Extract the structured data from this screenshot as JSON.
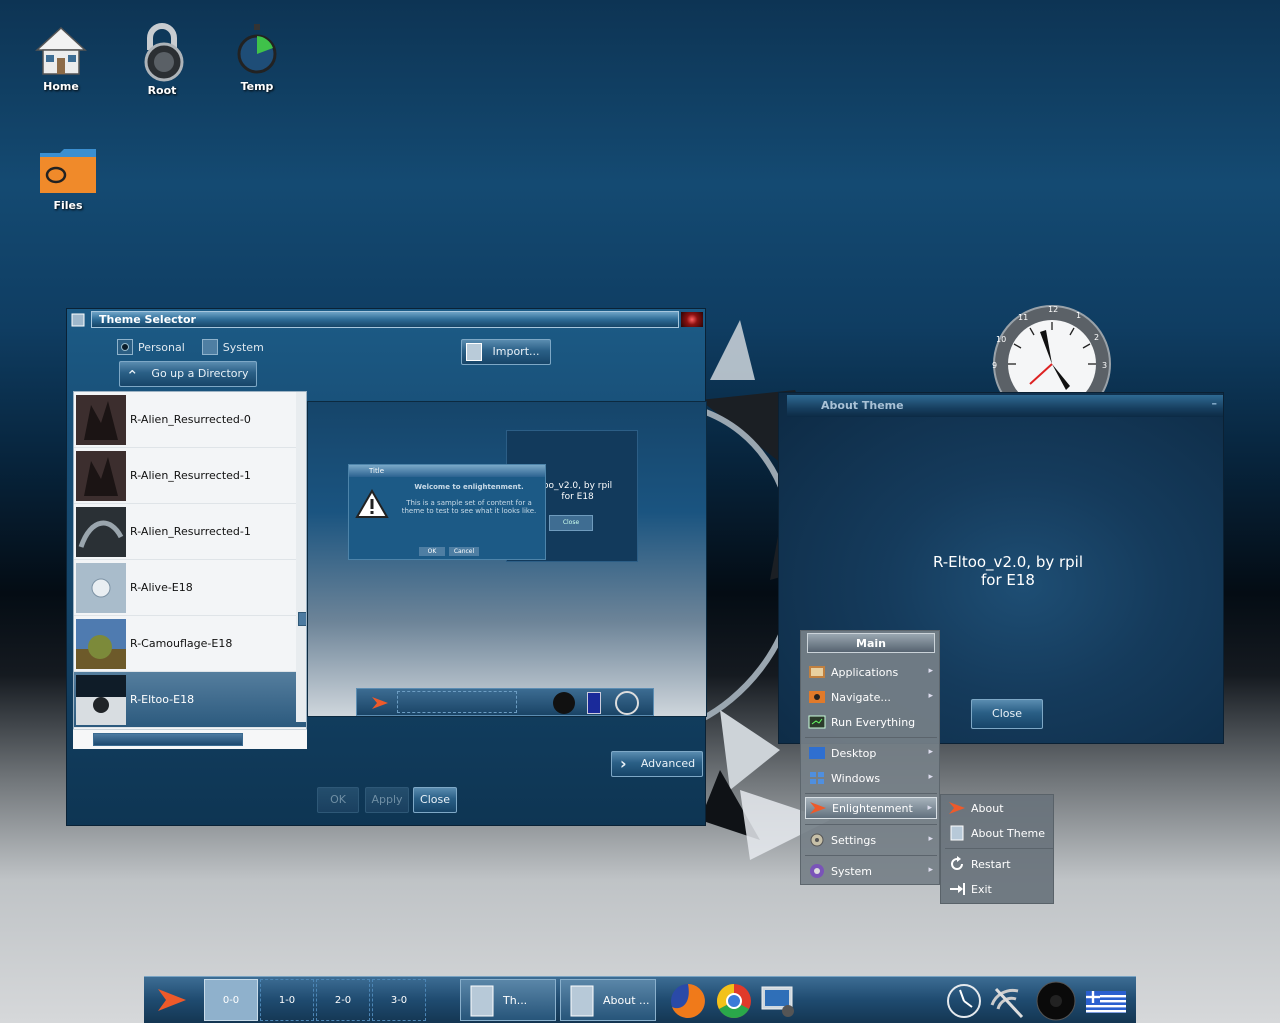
{
  "desktop": {
    "icons": [
      {
        "label": "Home"
      },
      {
        "label": "Root"
      },
      {
        "label": "Temp"
      },
      {
        "label": "Files"
      }
    ]
  },
  "clock": {
    "numbers": [
      "12",
      "1",
      "2",
      "3",
      "9",
      "10",
      "11"
    ]
  },
  "theme_selector": {
    "title": "Theme Selector",
    "radio_personal": "Personal",
    "radio_system": "System",
    "selected_source": "Personal",
    "import_button": "Import...",
    "go_up_button": "Go up a Directory",
    "themes": [
      {
        "name": "R-Alien_Resurrected-0"
      },
      {
        "name": "R-Alien_Resurrected-1"
      },
      {
        "name": "R-Alien_Resurrected-1"
      },
      {
        "name": "R-Alive-E18"
      },
      {
        "name": "R-Camouflage-E18"
      },
      {
        "name": "R-Eltoo-E18"
      }
    ],
    "selected_theme": "R-Eltoo-E18",
    "preview": {
      "dialog_title": "Title",
      "dialog_heading": "Welcome to enlightenment.",
      "dialog_body": "This is a sample set of content for a theme to test to see what it looks like.",
      "dialog_ok": "OK",
      "dialog_cancel": "Cancel",
      "back_text_1": "oo_v2.0, by rpil",
      "back_text_2": "for E18",
      "back_close": "Close"
    },
    "advanced_button": "Advanced",
    "ok_button": "OK",
    "apply_button": "Apply",
    "close_button": "Close"
  },
  "about_theme": {
    "title": "About Theme",
    "text_line1": "R-Eltoo_v2.0, by rpil",
    "text_line2": "for E18",
    "close_button": "Close"
  },
  "main_menu": {
    "title": "Main",
    "items": [
      {
        "label": "Applications",
        "has_submenu": true
      },
      {
        "label": "Navigate...",
        "has_submenu": true
      },
      {
        "label": "Run Everything",
        "has_submenu": false
      },
      {
        "label": "Desktop",
        "has_submenu": true
      },
      {
        "label": "Windows",
        "has_submenu": true
      },
      {
        "label": "Enlightenment",
        "has_submenu": true
      },
      {
        "label": "Settings",
        "has_submenu": true
      },
      {
        "label": "System",
        "has_submenu": true
      }
    ],
    "submenu_arrow": "▸",
    "enlightenment_submenu": [
      {
        "label": "About"
      },
      {
        "label": "About Theme"
      },
      {
        "label": "Restart"
      },
      {
        "label": "Exit"
      }
    ]
  },
  "taskbar": {
    "pager": [
      "0-0",
      "1-0",
      "2-0",
      "3-0"
    ],
    "current_desk": "0-0",
    "tasks": [
      {
        "label": "Th..."
      },
      {
        "label": "About ..."
      }
    ]
  },
  "colors": {
    "accent": "#2a5f86",
    "titlebar": "#2d6b96",
    "menu_bg": "#768088"
  }
}
